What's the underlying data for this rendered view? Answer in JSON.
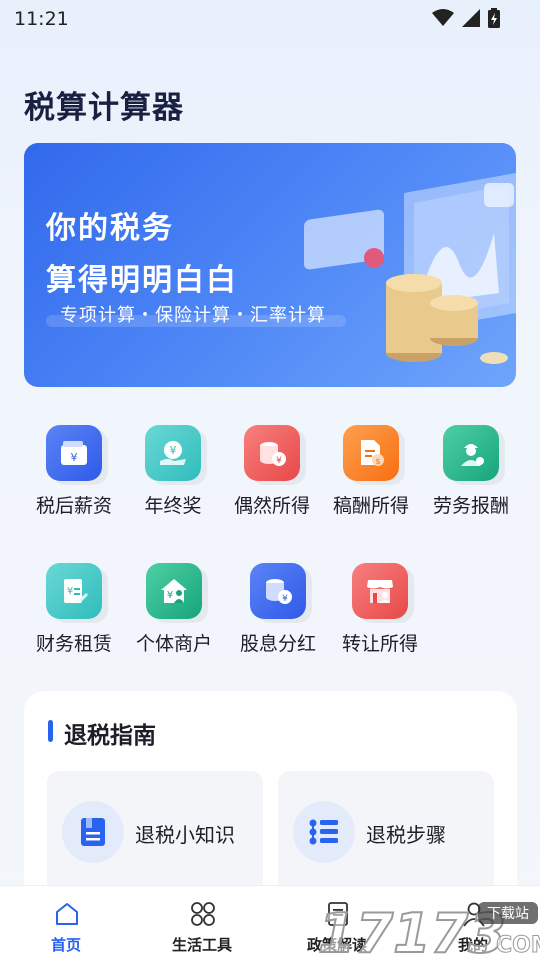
{
  "status_bar": {
    "time": "11:21"
  },
  "app": {
    "title": "税算计算器"
  },
  "banner": {
    "line1": "你的税务",
    "line2": "算得明明白白",
    "subtitle": "专项计算・保险计算・汇率计算"
  },
  "categories": [
    {
      "label": "税后薪资",
      "icon": "wallet-icon",
      "color": "#3560ee"
    },
    {
      "label": "年终奖",
      "icon": "coin-hand-icon",
      "color": "#3ac7c5"
    },
    {
      "label": "偶然所得",
      "icon": "coin-stack-icon",
      "color": "#ef5a59"
    },
    {
      "label": "稿酬所得",
      "icon": "document-coin-icon",
      "color": "#fb7f1e"
    },
    {
      "label": "劳务报酬",
      "icon": "worker-icon",
      "color": "#22b38a"
    },
    {
      "label": "财务租赁",
      "icon": "ledger-icon",
      "color": "#3ac7c5"
    },
    {
      "label": "个体商户",
      "icon": "house-person-icon",
      "color": "#22b38a"
    },
    {
      "label": "股息分红",
      "icon": "coins-icon",
      "color": "#3560ee"
    },
    {
      "label": "转让所得",
      "icon": "shop-icon",
      "color": "#ef5a59"
    }
  ],
  "guide": {
    "title": "退税指南",
    "tiles": [
      {
        "label": "退税小知识",
        "icon": "book-icon"
      },
      {
        "label": "退税步骤",
        "icon": "steps-list-icon"
      }
    ]
  },
  "nav": {
    "items": [
      {
        "label": "首页",
        "icon": "home-icon",
        "active": true
      },
      {
        "label": "生活工具",
        "icon": "grid-icon",
        "active": false
      },
      {
        "label": "政策解读",
        "icon": "document-icon",
        "active": false
      },
      {
        "label": "我的",
        "icon": "user-icon",
        "active": false
      }
    ]
  },
  "watermark": {
    "text": "17173",
    "sub": "下载站",
    "suffix": "COM"
  },
  "colors": {
    "accent": "#2a63f0",
    "banner": "#3c74f0"
  }
}
